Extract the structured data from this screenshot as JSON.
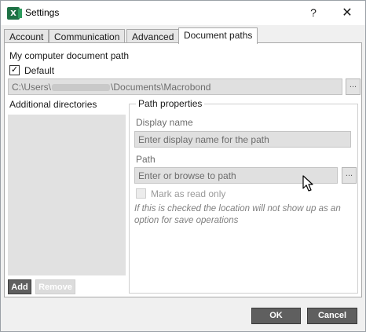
{
  "window": {
    "title": "Settings",
    "app_icon": "excel-icon",
    "app_icon_letter": "X",
    "help_label": "?",
    "close_label": "✕"
  },
  "tabs": [
    {
      "label": "Account",
      "active": false
    },
    {
      "label": "Communication",
      "active": false
    },
    {
      "label": "Advanced",
      "active": false
    },
    {
      "label": "Document paths",
      "active": true
    }
  ],
  "document_paths": {
    "my_path_label": "My computer document path",
    "default_label": "Default",
    "default_checked": true,
    "path_prefix": "C:\\Users\\",
    "path_suffix": "\\Documents\\Macrobond",
    "browse_label": "...",
    "additional_label": "Additional directories",
    "add_label": "Add",
    "remove_label": "Remove"
  },
  "path_properties": {
    "title": "Path properties",
    "display_name_label": "Display name",
    "display_name_placeholder": "Enter display name for the path",
    "path_label": "Path",
    "path_placeholder": "Enter or browse to path",
    "browse_label": "...",
    "read_only_label": "Mark as read only",
    "read_only_checked": false,
    "note": "If this is checked the location will not show up as an option for save operations"
  },
  "footer": {
    "ok_label": "OK",
    "cancel_label": "Cancel"
  },
  "colors": {
    "excel_green": "#1e7145",
    "dark_button": "#5f5f5f",
    "disabled_field": "#e0e0e0"
  }
}
